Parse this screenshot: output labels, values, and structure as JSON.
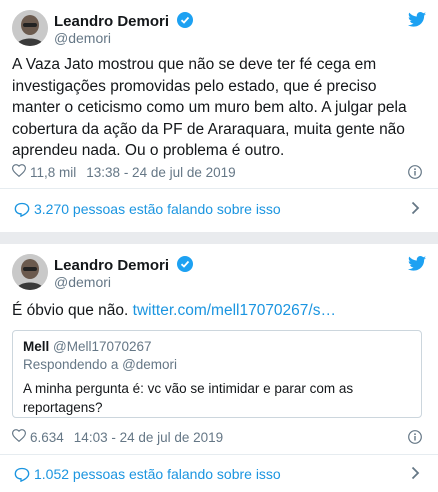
{
  "tweets": [
    {
      "author": "Leandro Demori",
      "handle": "@demori",
      "text": "A Vaza Jato mostrou que não se deve ter fé cega em investigações promovidas pelo estado, que é preciso manter o ceticismo como um muro bem alto. A julgar pela cobertura da ação da PF de Araraquara, muita gente não aprendeu nada. Ou o problema é outro.",
      "likes": "11,8 mil",
      "timestamp": "13:38 - 24 de jul de 2019",
      "talking": "3.270 pessoas estão falando sobre isso"
    },
    {
      "author": "Leandro Demori",
      "handle": "@demori",
      "text_prefix": "É óbvio que não. ",
      "link": "twitter.com/mell17070267/s…",
      "quote": {
        "author": "Mell",
        "handle": "@Mell17070267",
        "reply_to": "Respondendo a @demori",
        "text": "A minha pergunta é: vc vão se intimidar e parar com as reportagens?"
      },
      "likes": "6.634",
      "timestamp": "14:03 - 24 de jul de 2019",
      "talking": "1.052 pessoas estão falando sobre isso"
    }
  ],
  "colors": {
    "accent": "#1b95e0",
    "secondary": "#657786",
    "twitter": "#1da1f2"
  },
  "icons": [
    "avatar",
    "verified-icon",
    "twitter-bird-icon",
    "heart-icon",
    "info-icon",
    "comment-icon",
    "chevron-right-icon"
  ]
}
